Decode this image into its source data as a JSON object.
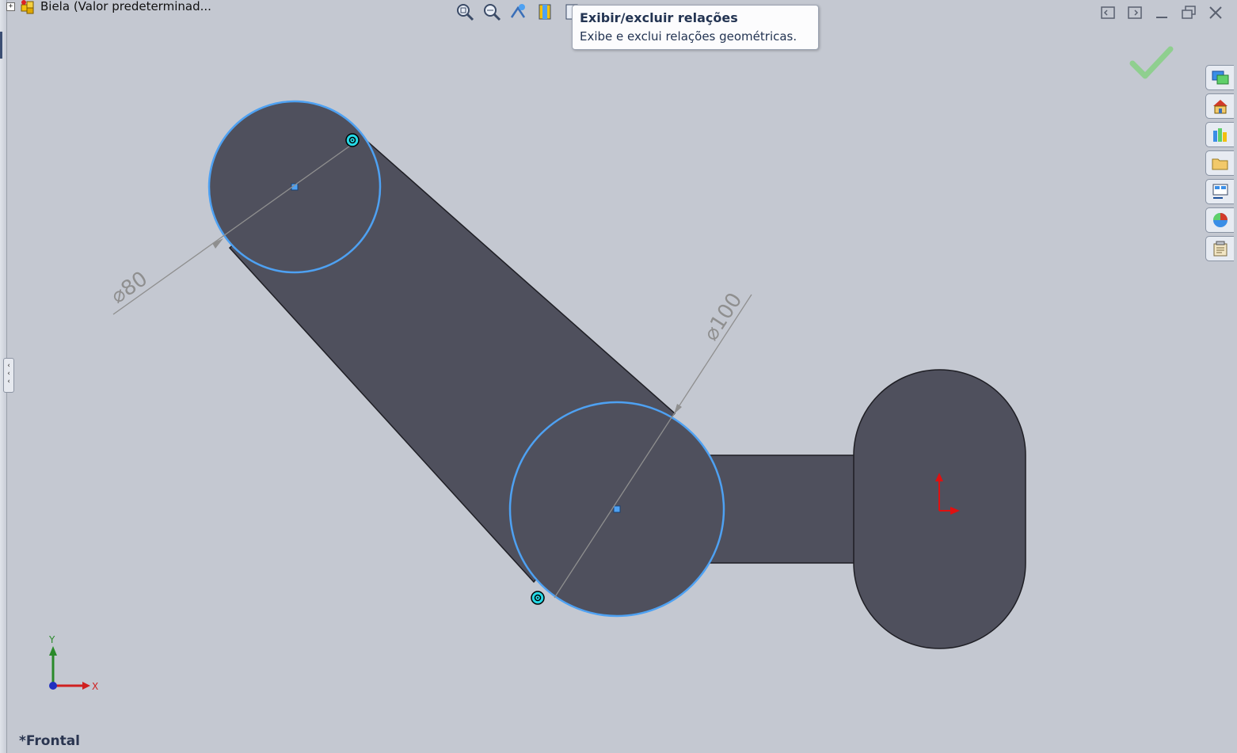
{
  "document": {
    "title": "Biela  (Valor predeterminad..."
  },
  "tooltip": {
    "title": "Exibir/excluir relações",
    "description": "Exibe e exclui relações geométricas."
  },
  "heads_up_toolbar": [
    "zoom-to-fit-icon",
    "zoom-to-area-icon",
    "previous-view-icon",
    "section-view-icon",
    "display-relations-icon"
  ],
  "window_controls": [
    "tile-left-icon",
    "tile-right-icon",
    "minimize-icon",
    "restore-icon",
    "close-icon"
  ],
  "task_pane_tabs": [
    "solidworks-resources-icon",
    "home-icon",
    "design-library-icon",
    "file-explorer-icon",
    "view-palette-icon",
    "appearances-icon",
    "custom-properties-icon"
  ],
  "sketch": {
    "dimensions": [
      {
        "label": "⌀80",
        "value": 80
      },
      {
        "label": "⌀100",
        "value": 100
      }
    ]
  },
  "triad": {
    "x_label": "X",
    "y_label": "Y"
  },
  "view": {
    "name": "*Frontal"
  },
  "colors": {
    "background": "#c4c8d1",
    "part_fill": "#4f505d",
    "selected_edge": "#4ea1f2",
    "confirm": "#8fcf8f",
    "origin": "#e01010"
  }
}
